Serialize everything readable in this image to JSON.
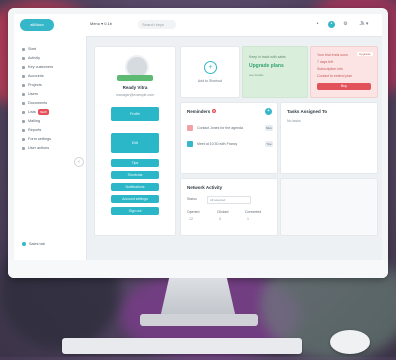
{
  "topbar": {
    "logo": "allMaxx",
    "menu": "Menu ▾ 0.1b",
    "search_placeholder": "Search keys",
    "account": "Jk ▾"
  },
  "sidebar": {
    "items": [
      {
        "label": "Start"
      },
      {
        "label": "Activity"
      },
      {
        "label": "Key customers"
      },
      {
        "label": "Accounts"
      },
      {
        "label": "Projects"
      },
      {
        "label": "Users"
      },
      {
        "label": "Documents"
      },
      {
        "label": "Lists",
        "badge": "NEW"
      },
      {
        "label": "Mailing"
      },
      {
        "label": "Reports"
      },
      {
        "label": "Form settings"
      },
      {
        "label": "User actions"
      }
    ],
    "footer": "Sales tab",
    "collapse_icon": "‹"
  },
  "profile": {
    "name": "Ready Vitra",
    "subtitle": "manager@example.com",
    "buttons": [
      "Profile",
      "Edit",
      "Tips",
      "Shortcuts",
      "Notifications",
      "Account settings",
      "Sign out"
    ]
  },
  "add_card": {
    "plus": "+",
    "label": "Add to Shortcut"
  },
  "promo": {
    "line1": "Keep in track with sales",
    "line2": "Upgrade plans",
    "line3": "see details"
  },
  "alert": {
    "line1": "Your trial ends soon",
    "tag": "Upgrade",
    "line2": "7 days left",
    "line3": "Subscription info",
    "line4": "Contact to extend plan",
    "button": "Buy"
  },
  "reminders": {
    "title": "Reminders",
    "badge": "2",
    "items": [
      {
        "text": "Contact Jones for the agenda",
        "pill": "Mon"
      },
      {
        "text": "Meet at 10:30 with Francy",
        "pill": "Tue"
      }
    ]
  },
  "assignments": {
    "title": "Tasks Assigned To",
    "sub": "No tasks"
  },
  "network": {
    "title": "Network Activity",
    "filter1": "Status",
    "filter2": "All selected",
    "cols": [
      {
        "head": "Opened",
        "val": "12"
      },
      {
        "head": "Clicked",
        "val": "3"
      },
      {
        "head": "Converted",
        "val": "1"
      }
    ]
  }
}
